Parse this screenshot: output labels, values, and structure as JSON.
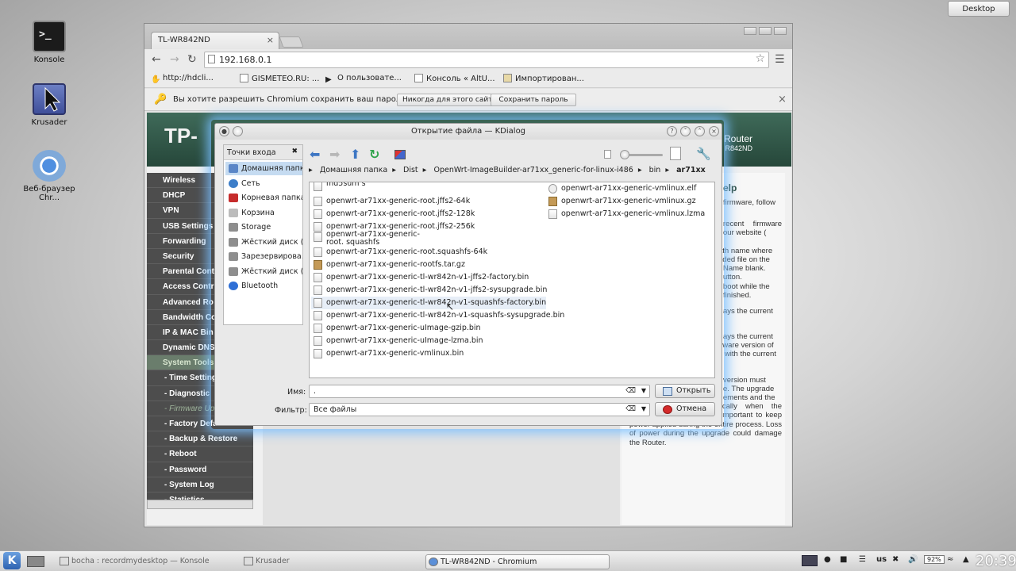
{
  "desktop": {
    "icons": [
      {
        "label": "Konsole"
      },
      {
        "label": "Krusader"
      },
      {
        "label": "Веб-браузер Chr..."
      }
    ],
    "desktop_button": "Desktop"
  },
  "browser": {
    "tab_title": "TL-WR842ND",
    "tab_close": "×",
    "url": "192.168.0.1",
    "bookmarks": [
      "http://hdcli...",
      "GISMETEO.RU: ...",
      "О пользовате...",
      "Консоль « AltU...",
      "Импортирован..."
    ],
    "infobar": {
      "message": "Вы хотите разрешить Chromium сохранить ваш пароль?",
      "never_button": "Никогда для этого сайта",
      "save_button": "Сохранить пароль",
      "close": "×"
    }
  },
  "router_page": {
    "logo": "TP-",
    "router_title": "Router",
    "router_model": "R842ND",
    "menu": [
      {
        "label": "Wireless"
      },
      {
        "label": "DHCP"
      },
      {
        "label": "VPN"
      },
      {
        "label": "USB Settings"
      },
      {
        "label": "Forwarding"
      },
      {
        "label": "Security"
      },
      {
        "label": "Parental Contr"
      },
      {
        "label": "Access Contr"
      },
      {
        "label": "Advanced Ro"
      },
      {
        "label": "Bandwidth Co"
      },
      {
        "label": "IP & MAC Bin"
      },
      {
        "label": "Dynamic DNS"
      },
      {
        "label": "System Tools"
      },
      {
        "label": "- Time Setting"
      },
      {
        "label": "- Diagnostic"
      },
      {
        "label": "- Firmware Up"
      },
      {
        "label": "- Factory Defa"
      },
      {
        "label": "- Backup & Restore"
      },
      {
        "label": "- Reboot"
      },
      {
        "label": "- Password"
      },
      {
        "label": "- System Log"
      },
      {
        "label": "- Statistics"
      }
    ],
    "help": {
      "title": "elp",
      "p1": "firmware, follow",
      "p2": "recent firmware our website (",
      "p3a": "ath name where",
      "p3b": "aded file on the",
      "p3c": "Name blank.",
      "p3d": "utton.",
      "p3e": "boot while the",
      "p3f": "finished.",
      "p4": "ays the current",
      "p5a": "ays the current",
      "p5b": "dware version of",
      "p5c": "d with the current",
      "p6a": "version must",
      "p6b": "e. The upgrade",
      "p6c": "ements and the",
      "p6d": "Router restarts automatically when the upgrade is complete. It is important to keep power applied during the entire process. Loss of power during the upgrade could damage the Router."
    }
  },
  "dialog": {
    "title": "Открытие файла — KDialog",
    "places_header": "Точки входа",
    "places": [
      {
        "label": "Домашняя папка",
        "icon": "home-folder-icon",
        "color": "#5a86c7"
      },
      {
        "label": "Сеть",
        "icon": "network-icon",
        "color": "#3d7ec9"
      },
      {
        "label": "Корневая папка",
        "icon": "root-folder-icon",
        "color": "#c62c2c"
      },
      {
        "label": "Корзина",
        "icon": "trash-icon",
        "color": "#bcbcbc"
      },
      {
        "label": "Storage",
        "icon": "drive-icon",
        "color": "#8e8e8e"
      },
      {
        "label": "Жёсткий диск (...",
        "icon": "drive-icon",
        "color": "#8e8e8e"
      },
      {
        "label": "Зарезервирова...",
        "icon": "drive-icon",
        "color": "#8e8e8e"
      },
      {
        "label": "Жёсткий диск (...",
        "icon": "drive-icon",
        "color": "#8e8e8e"
      },
      {
        "label": "Bluetooth",
        "icon": "bluetooth-icon",
        "color": "#2e6fd6"
      }
    ],
    "breadcrumb": [
      "Домашняя папка",
      "Dist",
      "OpenWrt-ImageBuilder-ar71xx_generic-for-linux-i486",
      "bin",
      "ar71xx"
    ],
    "files_col1": [
      "md5sum s",
      "openwrt-ar71xx-generic-root.jffs2-64k",
      "openwrt-ar71xx-generic-root.jffs2-128k",
      "openwrt-ar71xx-generic-root.jffs2-256k",
      "openwrt-ar71xx-generic-root. squashfs",
      "openwrt-ar71xx-generic-root.squashfs-64k",
      "openwrt-ar71xx-generic-rootfs.tar.gz",
      "openwrt-ar71xx-generic-tl-wr842n-v1-jffs2-factory.bin",
      "openwrt-ar71xx-generic-tl-wr842n-v1-jffs2-sysupgrade.bin",
      "openwrt-ar71xx-generic-tl-wr842n-v1-squashfs-factory.bin",
      "openwrt-ar71xx-generic-tl-wr842n-v1-squashfs-sysupgrade.bin",
      "openwrt-ar71xx-generic-uImage-gzip.bin",
      "openwrt-ar71xx-generic-uImage-lzma.bin",
      "openwrt-ar71xx-generic-vmlinux.bin"
    ],
    "files_col2": [
      "openwrt-ar71xx-generic-vmlinux.elf",
      "openwrt-ar71xx-generic-vmlinux.gz",
      "openwrt-ar71xx-generic-vmlinux.lzma"
    ],
    "name_label": "Имя:",
    "name_value": ".",
    "filter_label": "Фильтр:",
    "filter_value": "Все файлы",
    "open_button": "Открыть",
    "cancel_button": "Отмена"
  },
  "taskbar": {
    "tasks": [
      {
        "label": "bocha : recordmydesktop — Konsole"
      },
      {
        "label": "Krusader"
      },
      {
        "label": "TL-WR842ND - Chromium"
      }
    ],
    "keyboard_layout": "us",
    "battery": "92%",
    "clock": "20:39"
  }
}
